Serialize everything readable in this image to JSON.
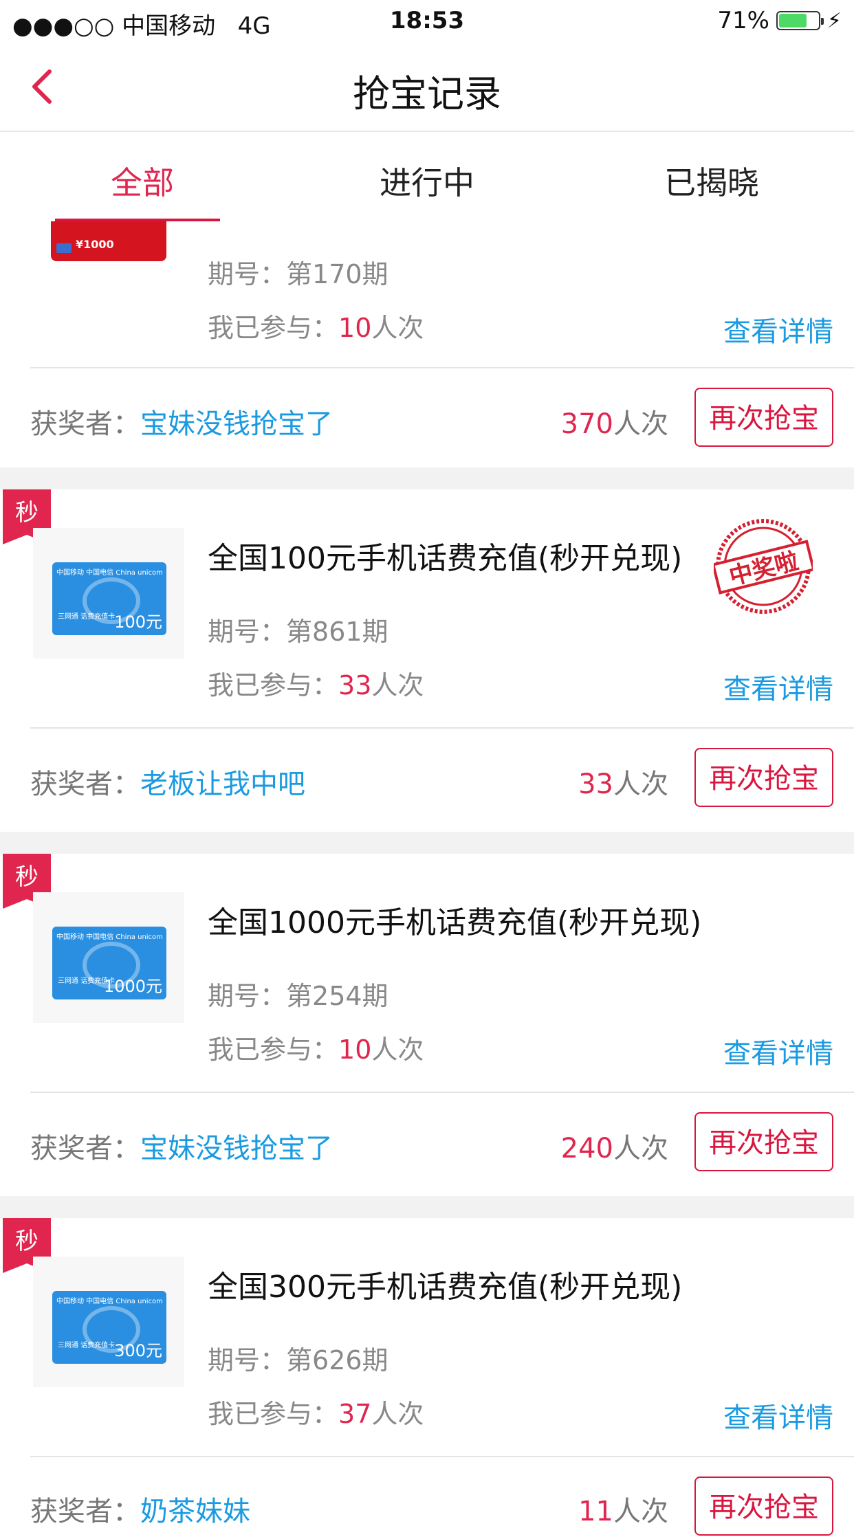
{
  "status_bar": {
    "carrier": "●●●○○ 中国移动",
    "network": "4G",
    "time": "18:53",
    "battery": "71%",
    "battery_level": 0.71,
    "battery_color": "#4cd964"
  },
  "nav": {
    "title": "抢宝记录",
    "back_icon": "chevron-left-icon",
    "accent": "#e0264f"
  },
  "tabs": [
    {
      "label": "全部",
      "active": true
    },
    {
      "label": "进行中",
      "active": false
    },
    {
      "label": "已揭晓",
      "active": false
    }
  ],
  "labels": {
    "period_prefix": "期号：",
    "joined_prefix": "我已参与：",
    "times_unit": "人次",
    "detail": "查看详情",
    "winner_prefix": "获奖者：",
    "again": "再次抢宝",
    "badge": "秒",
    "stamp": "中奖啦"
  },
  "records": [
    {
      "title": "",
      "period": "第170期",
      "joined": "10",
      "winner": "宝妹没钱抢宝了",
      "total": "370",
      "card_value": "¥1000",
      "won": false
    },
    {
      "title": "全国100元手机话费充值(秒开兑现)",
      "period": "第861期",
      "joined": "33",
      "winner": "老板让我中吧",
      "total": "33",
      "card_value": "100元",
      "won": true
    },
    {
      "title": "全国1000元手机话费充值(秒开兑现)",
      "period": "第254期",
      "joined": "10",
      "winner": "宝妹没钱抢宝了",
      "total": "240",
      "card_value": "1000元",
      "won": false
    },
    {
      "title": "全国300元手机话费充值(秒开兑现)",
      "period": "第626期",
      "joined": "37",
      "winner": "奶茶妹妹",
      "total": "11",
      "card_value": "300元",
      "won": false
    }
  ],
  "card_image_text": {
    "logo": "中国移动 中国电信 China unicom",
    "small": "三网通 话费充值卡"
  }
}
